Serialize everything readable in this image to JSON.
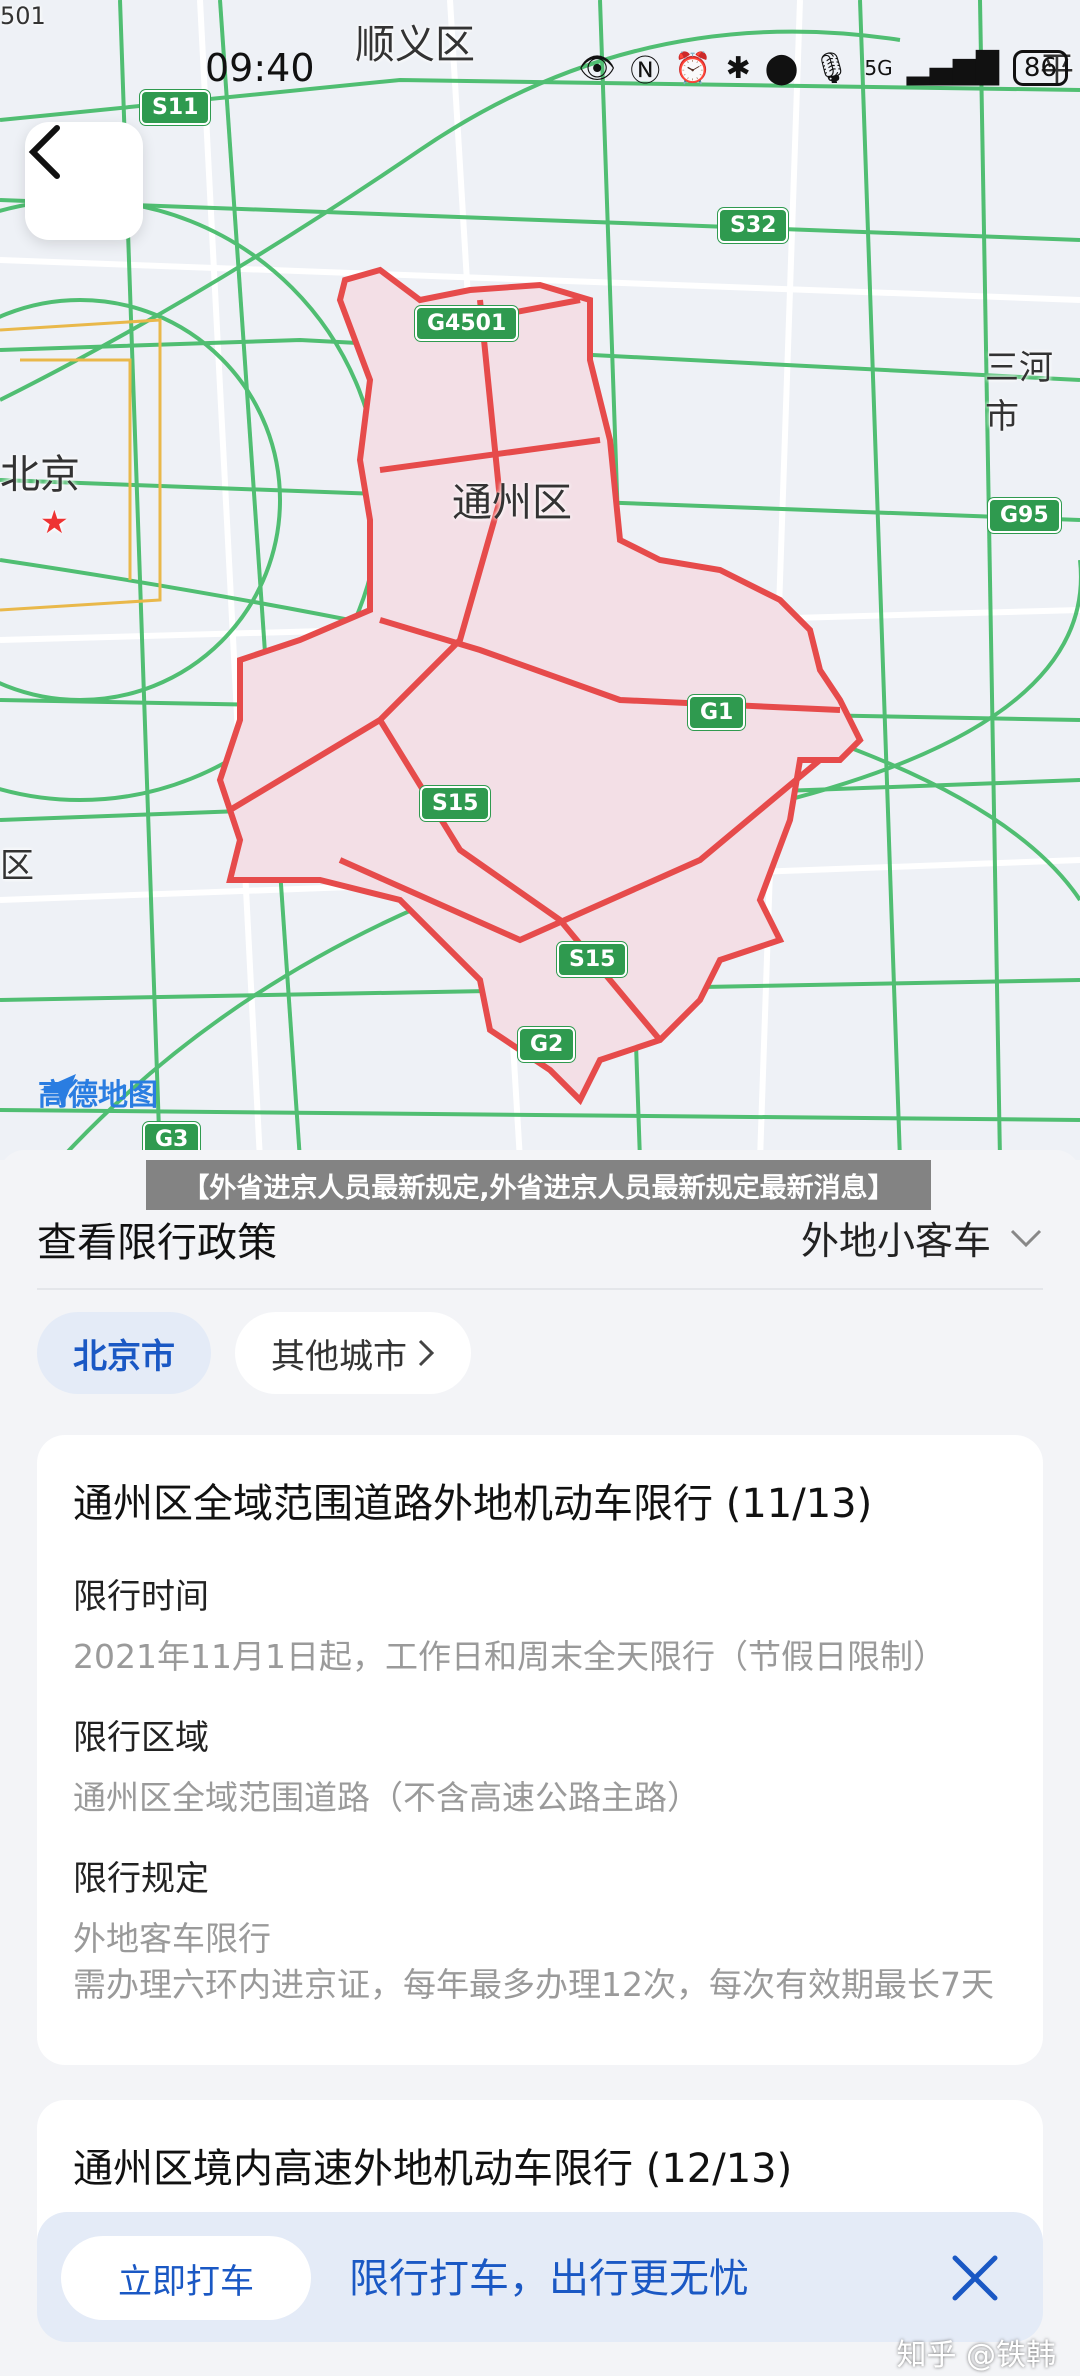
{
  "status": {
    "time": "09:40",
    "battery": "86",
    "network": "5G"
  },
  "map": {
    "labels": {
      "shunyi": "顺义区",
      "beijing": "北京",
      "tongzhou": "通州区",
      "sanhe": "三河市",
      "edge_left": "区",
      "edge_right": "平",
      "edge_top": "501"
    },
    "highways": [
      "S11",
      "S32",
      "G4501",
      "G95",
      "G1",
      "S15",
      "S15",
      "G2",
      "G3"
    ],
    "logo": "高德地图",
    "colors": {
      "district_fill": "#f3dfe6",
      "district_border": "#e64b4b",
      "road": "#3fb964"
    }
  },
  "banner": "【外省进京人员最新规定,外省进京人员最新规定最新消息】",
  "panel": {
    "title": "查看限行政策",
    "vehicle_type": "外地小客车",
    "chips": {
      "active": "北京市",
      "other": "其他城市"
    },
    "card1": {
      "title": "通州区全域范围道路外地机动车限行 (11/13)",
      "time_label": "限行时间",
      "time_value": "2021年11月1日起，工作日和周末全天限行（节假日限制）",
      "area_label": "限行区域",
      "area_value": "通州区全域范围道路（不含高速公路主路）",
      "rule_label": "限行规定",
      "rule_line1": "外地客车限行",
      "rule_line2": "需办理六环内进京证，每年最多办理12次，每次有效期最长7天"
    },
    "card2": {
      "title": "通州区境内高速外地机动车限行 (12/13)"
    }
  },
  "bottom_bar": {
    "button": "立即打车",
    "text": "限行打车，出行更无忧"
  },
  "watermark": "知乎 @铁韩"
}
